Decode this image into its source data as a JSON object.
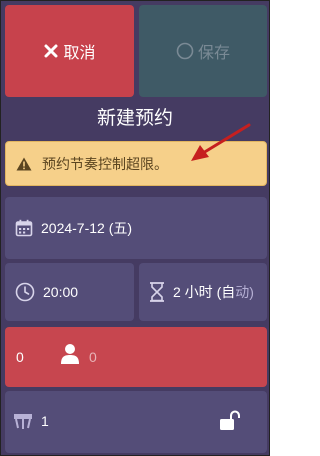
{
  "actions": {
    "cancel_label": "取消",
    "save_label": "保存"
  },
  "page_title": "新建预约",
  "alert": {
    "message": "预约节奏控制超限。"
  },
  "booking": {
    "date": "2024-7-12 (五)",
    "time": "20:00",
    "duration": "2 小时 (自",
    "duration_fade": "动)",
    "guests_adults": "0",
    "guests_children": "0",
    "table_count": "1"
  },
  "colors": {
    "cancel": "#c7424c",
    "save": "#3f5a66",
    "background": "#453b62",
    "card": "#544d78",
    "alert": "#f6d08a",
    "annotation_arrow": "#c61f1f"
  }
}
